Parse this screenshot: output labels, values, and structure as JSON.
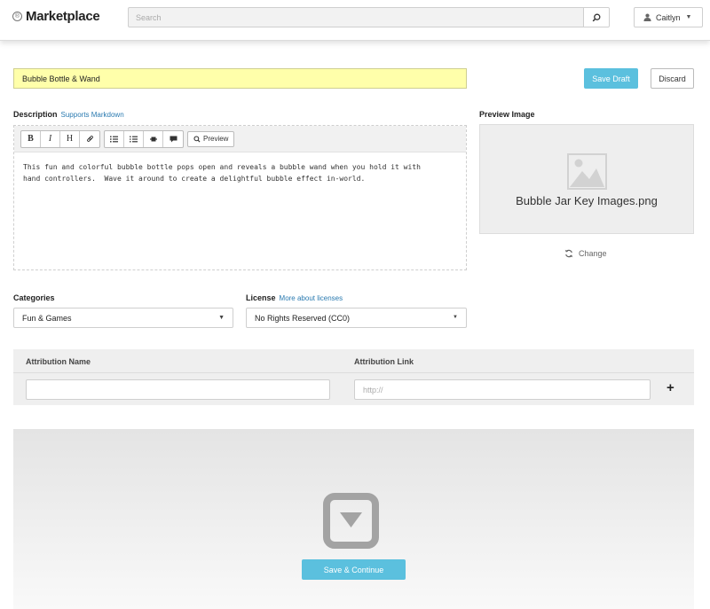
{
  "header": {
    "logo_mark": "®",
    "logo_text": "Marketplace",
    "search_placeholder": "Search",
    "user_name": "Caitlyn"
  },
  "form": {
    "title_value": "Bubble Bottle & Wand",
    "save_draft_label": "Save Draft",
    "discard_label": "Discard"
  },
  "description": {
    "label": "Description",
    "markdown_link": "Supports Markdown",
    "toolbar": {
      "bold": "B",
      "italic": "I",
      "heading": "H",
      "preview": "Preview"
    },
    "text": "This fun and colorful bubble bottle pops open and reveals a bubble wand when you hold it with\nhand controllers.  Wave it around to create a delightful bubble effect in-world."
  },
  "preview_image": {
    "label": "Preview Image",
    "file_name": "Bubble Jar Key Images.png",
    "change_label": "Change"
  },
  "categories": {
    "label": "Categories",
    "selected": "Fun & Games"
  },
  "license": {
    "label": "License",
    "link": "More about licenses",
    "selected": "No Rights Reserved (CC0)"
  },
  "attribution": {
    "name_header": "Attribution Name",
    "link_header": "Attribution Link",
    "name_value": "",
    "link_placeholder": "http://"
  },
  "upload": {
    "continue_label": "Save & Continue"
  },
  "colors": {
    "accent": "#5bc0de",
    "title_highlight": "#ffffaa",
    "link": "#2a7ab0"
  }
}
